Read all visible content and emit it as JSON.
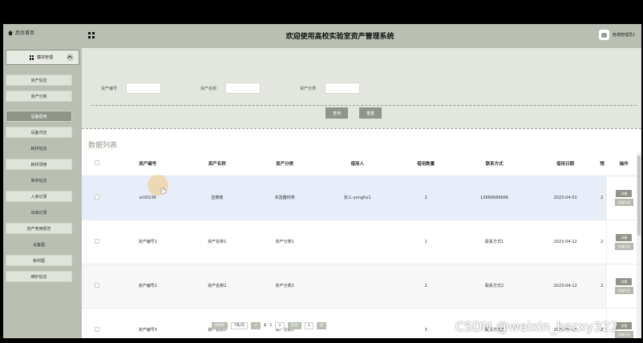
{
  "header": {
    "home_label": "后台首页",
    "title": "欢迎使用高校实验室资产管理系统",
    "user_name": "普通管理员1"
  },
  "sidebar": {
    "group_label": "模块管理",
    "items": [
      {
        "label": "资产信息",
        "type": "item"
      },
      {
        "label": "资产分类",
        "type": "item"
      },
      {
        "label": "设备借用",
        "type": "active"
      },
      {
        "label": "设备归还",
        "type": "item"
      },
      {
        "label": "耗材信息",
        "type": "label"
      },
      {
        "label": "耗材领用",
        "type": "item"
      },
      {
        "label": "库存信息",
        "type": "label"
      },
      {
        "label": "入库记录",
        "type": "item"
      },
      {
        "label": "出库记录",
        "type": "label"
      },
      {
        "label": "资产使用报告",
        "type": "item"
      },
      {
        "label": "设备图",
        "type": "label"
      },
      {
        "label": "耗材图",
        "type": "item"
      },
      {
        "label": "维护信息",
        "type": "item"
      }
    ]
  },
  "search": {
    "asset_no_label": "资产编号",
    "asset_name_label": "资产名称",
    "asset_category_label": "资产分类",
    "asset_no_value": "",
    "asset_name_value": "",
    "asset_category_value": "",
    "query_label": "查询",
    "reset_label": "重置"
  },
  "list_title": "数据列表",
  "table": {
    "columns": [
      "资产编号",
      "资产名称",
      "资产分类",
      "借用人",
      "借用数量",
      "联系方式",
      "借用日期",
      "预",
      "操作"
    ],
    "rows": [
      {
        "no": "zc00236",
        "name": "显微镜",
        "category": "实验器材类",
        "borrower": "张三-yonghu1",
        "qty": "2",
        "contact": "13666666666",
        "date": "2023-04-01",
        "extra": "2"
      },
      {
        "no": "资产编号1",
        "name": "资产名称1",
        "category": "资产分类1",
        "borrower": "",
        "qty": "1",
        "contact": "联系方式1",
        "date": "2023-04-12",
        "extra": "2"
      },
      {
        "no": "资产编号2",
        "name": "资产名称2",
        "category": "资产分类2",
        "borrower": "",
        "qty": "2",
        "contact": "联系方式2",
        "date": "2023-04-12",
        "extra": "2"
      },
      {
        "no": "资产编号3",
        "name": "资产名称3",
        "category": "资产分类3",
        "borrower": "",
        "qty": "3",
        "contact": "联系方式3",
        "date": "2023-04-12",
        "extra": "2"
      }
    ],
    "op_detail": "详情",
    "op_return": "设备归还"
  },
  "pagination": {
    "total": "共8条",
    "page_size": "7条/页",
    "prev": "<",
    "pages": [
      "1",
      "2"
    ],
    "next": ">",
    "goto_label": "前往",
    "goto_value": "1",
    "page_unit": "页"
  },
  "watermark": "CSDN @weixin_bscxy322"
}
